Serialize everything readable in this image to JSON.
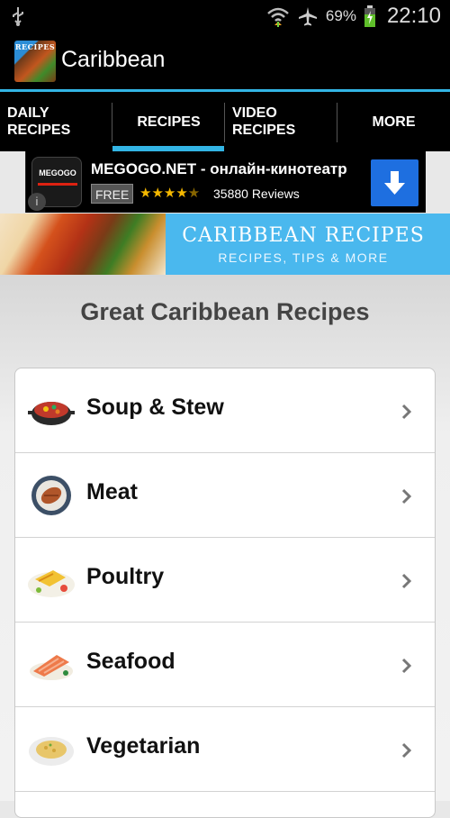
{
  "status_bar": {
    "battery_percent": "69%",
    "time": "22:10",
    "icons": [
      "usb-icon",
      "wifi-icon",
      "airplane-icon",
      "battery-charging-icon"
    ]
  },
  "action_bar": {
    "title": "Caribbean",
    "app_icon_label": "RECIPES"
  },
  "tabs": [
    {
      "label": "DAILY\nRECIPES",
      "selected": false
    },
    {
      "label": "RECIPES",
      "selected": true
    },
    {
      "label": "VIDEO\nRECIPES",
      "selected": false
    },
    {
      "label": "MORE",
      "selected": false
    }
  ],
  "ad": {
    "logo_text": "MEGOGO",
    "title": "MEGOGO.NET - онлайн-кинотеатр",
    "price": "FREE",
    "rating_stars": 4.5,
    "reviews": "35880 Reviews",
    "info_icon": "info-icon",
    "download_icon": "download-arrow-icon"
  },
  "banner": {
    "title": "CARIBBEAN RECIPES",
    "subtitle": "RECIPES, TIPS & MORE"
  },
  "main": {
    "heading": "Great Caribbean Recipes",
    "categories": [
      {
        "name": "Soup & Stew",
        "icon": "soup-pot-icon"
      },
      {
        "name": "Meat",
        "icon": "meat-plate-icon"
      },
      {
        "name": "Poultry",
        "icon": "poultry-dish-icon"
      },
      {
        "name": "Seafood",
        "icon": "seafood-icon"
      },
      {
        "name": "Vegetarian",
        "icon": "vegetarian-plate-icon"
      }
    ]
  },
  "colors": {
    "accent": "#33b5e5",
    "ad_download": "#1e6fe0",
    "banner_bg": "#4ab8ee",
    "stars": "#f5b800"
  }
}
